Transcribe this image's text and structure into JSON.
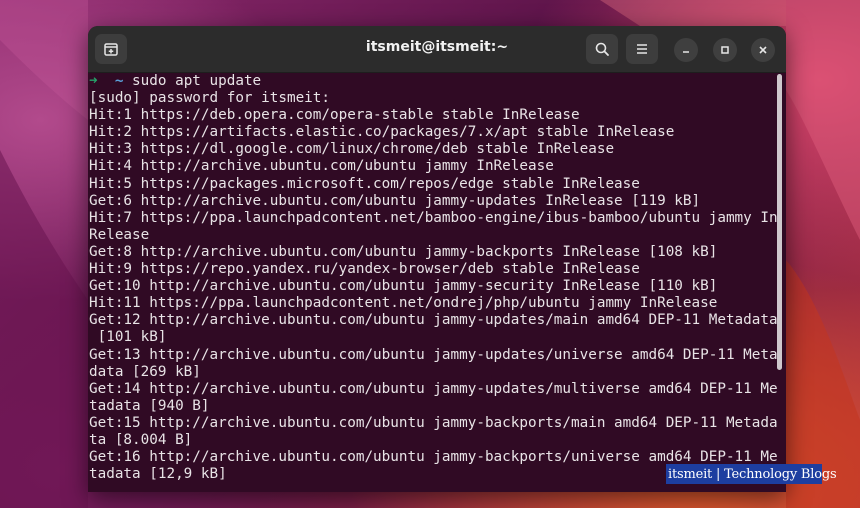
{
  "window": {
    "title": "itsmeit@itsmeit:~"
  },
  "toolbar": {
    "new_tab_icon": "new-tab-icon",
    "search_icon": "search-icon",
    "menu_icon": "hamburger-menu-icon",
    "minimize_icon": "minimize-icon",
    "maximize_icon": "maximize-icon",
    "close_icon": "close-icon"
  },
  "prompt": {
    "arrow": "➜",
    "dir": "~",
    "command": "sudo apt update"
  },
  "output": [
    "[sudo] password for itsmeit:",
    "Hit:1 https://deb.opera.com/opera-stable stable InRelease",
    "Hit:2 https://artifacts.elastic.co/packages/7.x/apt stable InRelease",
    "Hit:3 https://dl.google.com/linux/chrome/deb stable InRelease",
    "Hit:4 http://archive.ubuntu.com/ubuntu jammy InRelease",
    "Hit:5 https://packages.microsoft.com/repos/edge stable InRelease",
    "Get:6 http://archive.ubuntu.com/ubuntu jammy-updates InRelease [119 kB]",
    "Hit:7 https://ppa.launchpadcontent.net/bamboo-engine/ibus-bamboo/ubuntu jammy In",
    "Release",
    "Get:8 http://archive.ubuntu.com/ubuntu jammy-backports InRelease [108 kB]",
    "Hit:9 https://repo.yandex.ru/yandex-browser/deb stable InRelease",
    "Get:10 http://archive.ubuntu.com/ubuntu jammy-security InRelease [110 kB]",
    "Hit:11 https://ppa.launchpadcontent.net/ondrej/php/ubuntu jammy InRelease",
    "Get:12 http://archive.ubuntu.com/ubuntu jammy-updates/main amd64 DEP-11 Metadata",
    " [101 kB]",
    "Get:13 http://archive.ubuntu.com/ubuntu jammy-updates/universe amd64 DEP-11 Meta",
    "data [269 kB]",
    "Get:14 http://archive.ubuntu.com/ubuntu jammy-updates/multiverse amd64 DEP-11 Me",
    "tadata [940 B]",
    "Get:15 http://archive.ubuntu.com/ubuntu jammy-backports/main amd64 DEP-11 Metada",
    "ta [8.004 B]",
    "Get:16 http://archive.ubuntu.com/ubuntu jammy-backports/universe amd64 DEP-11 Me",
    "tadata [12,9 kB]"
  ],
  "watermark": {
    "text": "itsmeit | Technology Blogs"
  },
  "colors": {
    "terminal_bg": "#300a24",
    "titlebar_bg": "#2c2c2c",
    "prompt_arrow": "#26a269",
    "prompt_dir": "#5a9fd8",
    "watermark_bg": "#1d3ea0"
  }
}
